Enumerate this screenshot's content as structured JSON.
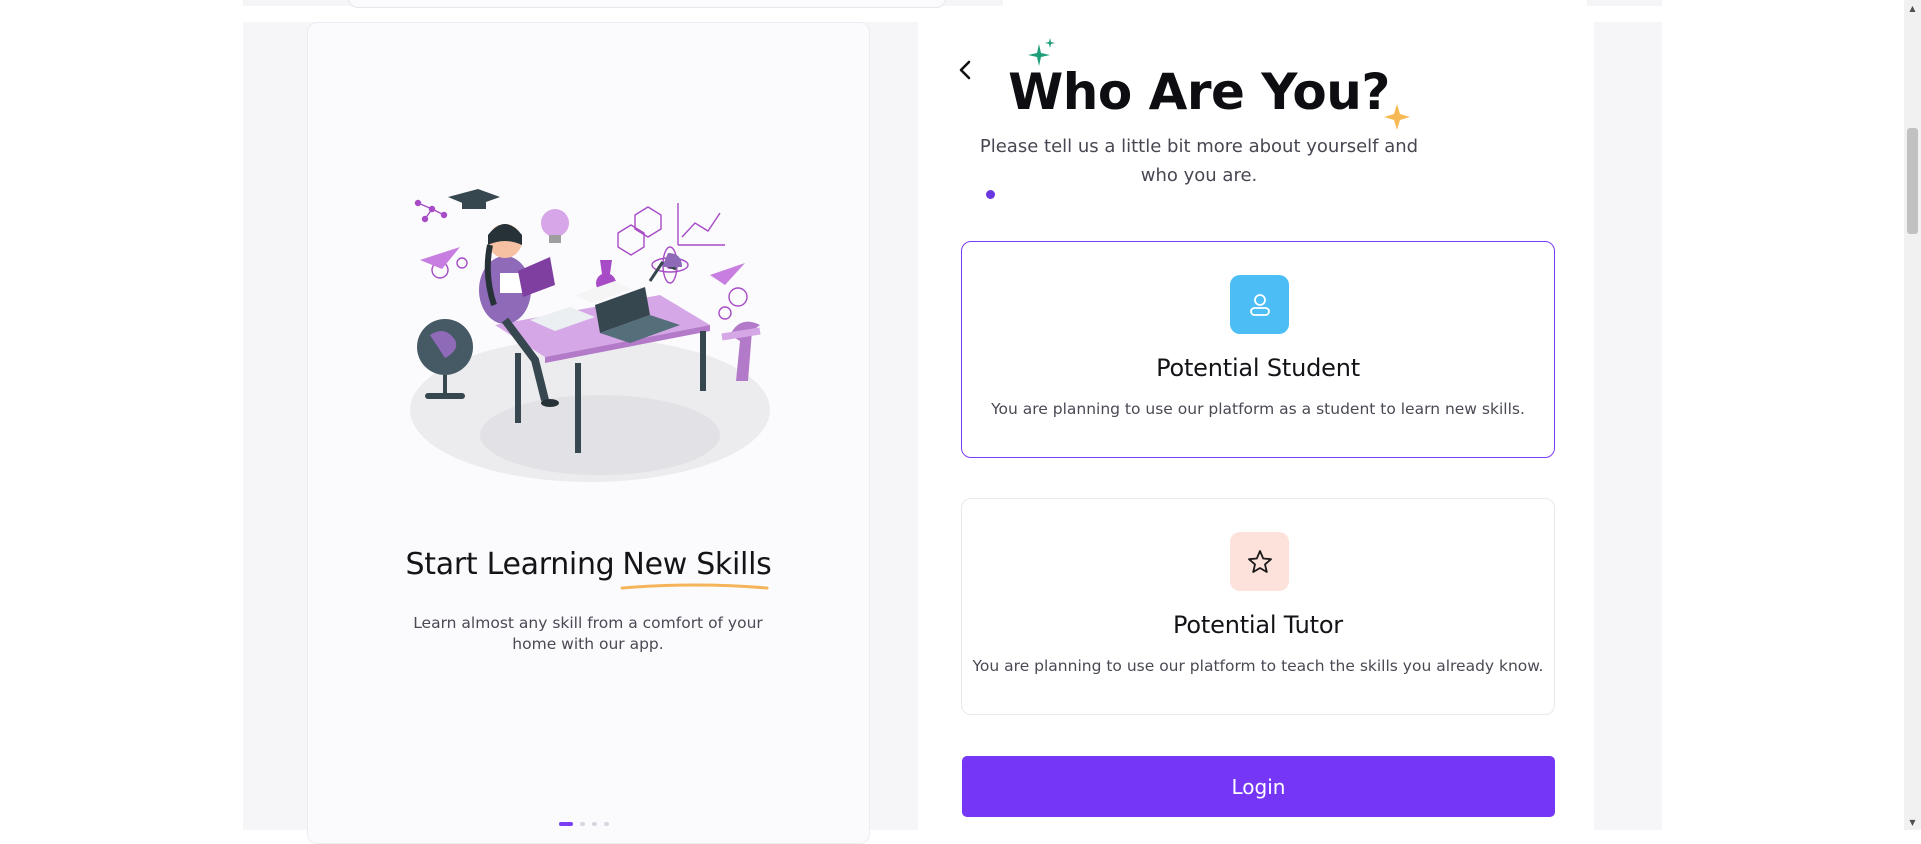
{
  "left_panel": {
    "title_part1": "Start Learning",
    "title_part2": "New Skills",
    "description": "Learn almost any skill from a comfort of your home with our app.",
    "carousel": {
      "total": 4,
      "active_index": 0
    },
    "illustration": "student-studying-at-desk-illustration"
  },
  "main": {
    "back_icon": "chevron-left-icon",
    "heading": "Who Are You?",
    "subheading": "Please tell us a little bit more about yourself and who you are.",
    "roles": [
      {
        "title": "Potential Student",
        "description": "You are planning to use our platform as a student to learn new skills.",
        "icon": "user-icon",
        "selected": true
      },
      {
        "title": "Potential Tutor",
        "description": "You are planning to use our platform to teach the skills you already know.",
        "icon": "star-icon",
        "selected": false
      }
    ],
    "login_label": "Login"
  },
  "colors": {
    "accent": "#7537f5",
    "student_icon_bg": "#4dbdf5",
    "tutor_icon_bg": "#fde2dc",
    "sparkle_green": "#1f9e7a",
    "sparkle_orange": "#f7b955",
    "title_underline": "#f5b45a"
  }
}
